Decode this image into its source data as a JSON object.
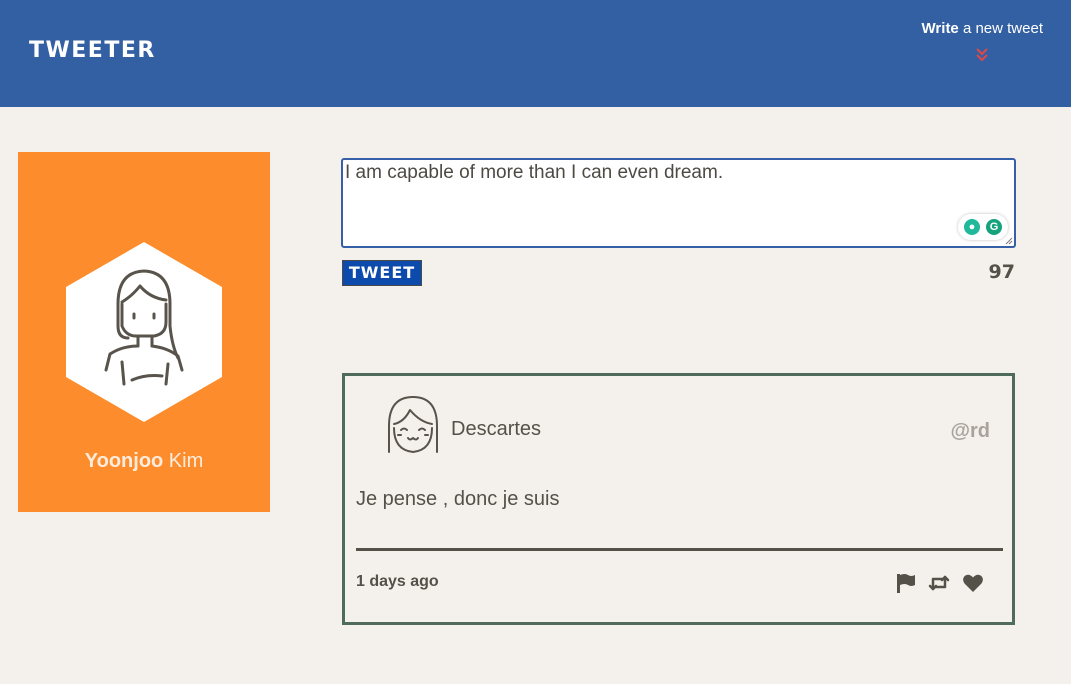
{
  "header": {
    "brand": "TWEETER",
    "compose_bold": "Write",
    "compose_rest": " a new tweet",
    "compose_icon": "double-chevron-down-icon",
    "compose_icon_color": "#e04747"
  },
  "profile": {
    "first_name": "Yoonjoo",
    "last_name": " Kim",
    "card_color": "#fd8c2d"
  },
  "compose": {
    "text": "I am capable of more than I can even dream.",
    "button_label": "TWEET",
    "counter": "97"
  },
  "tweets": [
    {
      "author": "Descartes",
      "handle": "@rd",
      "text": "Je pense , donc je suis",
      "time": "1 days ago",
      "actions": [
        "flag-icon",
        "retweet-icon",
        "heart-icon"
      ]
    }
  ],
  "colors": {
    "header_bg": "#3360a2",
    "page_bg": "#f4f1ec",
    "tweet_border": "#4e6b5c",
    "tweet_button_bg": "#0c4aac"
  }
}
